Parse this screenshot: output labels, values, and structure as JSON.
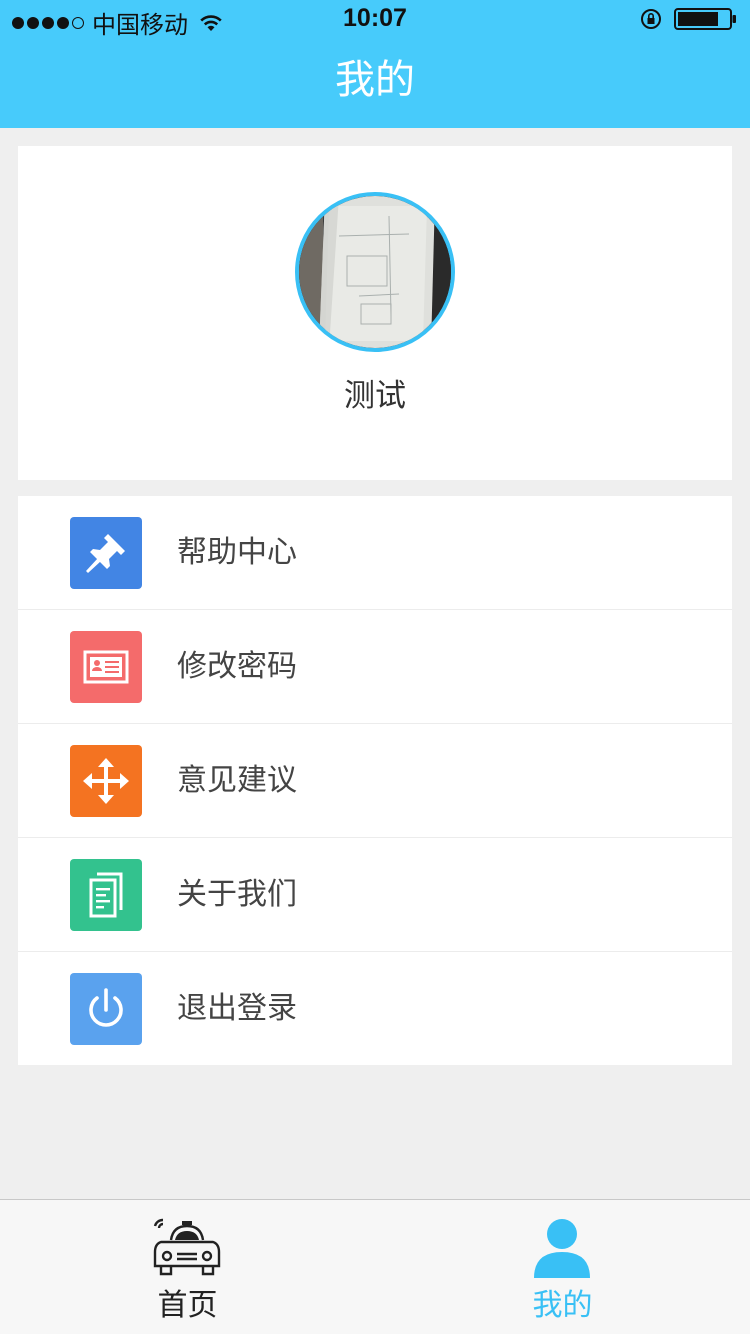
{
  "status_bar": {
    "carrier": "中国移动",
    "time": "10:07"
  },
  "nav": {
    "title": "我的"
  },
  "profile": {
    "name": "测试"
  },
  "menu": {
    "items": [
      {
        "label": "帮助中心",
        "icon": "pushpin-icon",
        "color": "#4285e4"
      },
      {
        "label": "修改密码",
        "icon": "id-card-icon",
        "color": "#f46b6b"
      },
      {
        "label": "意见建议",
        "icon": "move-arrows-icon",
        "color": "#f47321"
      },
      {
        "label": "关于我们",
        "icon": "documents-icon",
        "color": "#33c28e"
      },
      {
        "label": "退出登录",
        "icon": "power-icon",
        "color": "#5aa2ee"
      }
    ]
  },
  "tabbar": {
    "tabs": [
      {
        "label": "首页",
        "icon": "taxi-icon",
        "active": false
      },
      {
        "label": "我的",
        "icon": "user-icon",
        "active": true
      }
    ]
  },
  "colors": {
    "header": "#47cbfb",
    "accent": "#39c0f5",
    "background": "#efefef"
  }
}
